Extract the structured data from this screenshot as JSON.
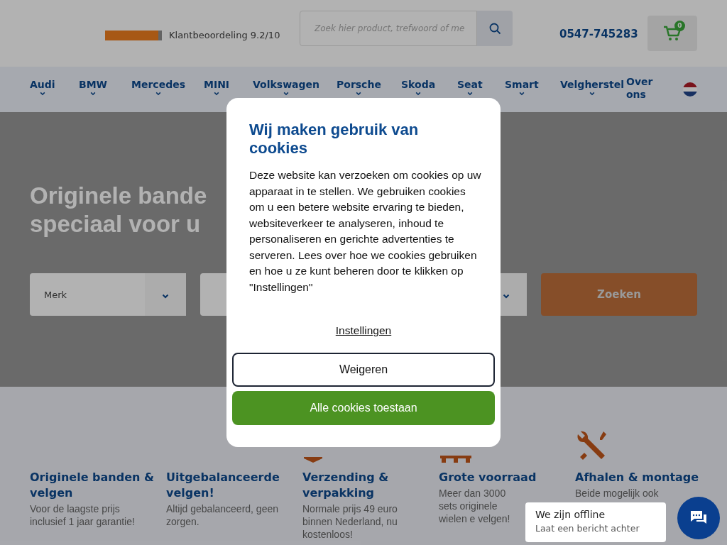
{
  "header": {
    "rating": {
      "level": 0.94,
      "text": "Klantbeoordeling 9.2/10"
    },
    "search": {
      "placeholder": "Zoek hier product, trefwoord of me"
    },
    "phone": "0547-745283",
    "cart": {
      "count": "0"
    }
  },
  "nav": {
    "items": [
      {
        "label": "Audi",
        "has_dropdown": true
      },
      {
        "label": "BMW",
        "has_dropdown": true
      },
      {
        "label": "Mercedes",
        "has_dropdown": true
      },
      {
        "label": "MINI",
        "has_dropdown": true
      },
      {
        "label": "Volkswagen",
        "has_dropdown": true
      },
      {
        "label": "Porsche",
        "has_dropdown": true
      },
      {
        "label": "Skoda",
        "has_dropdown": true
      },
      {
        "label": "Seat",
        "has_dropdown": true
      },
      {
        "label": "Smart",
        "has_dropdown": true
      },
      {
        "label": "Velgherstel",
        "has_dropdown": true
      },
      {
        "label": "Over ons",
        "has_dropdown": false
      }
    ]
  },
  "hero": {
    "title_lines": [
      "Originele bande",
      "speciaal voor u"
    ],
    "selects": [
      {
        "kind": "select",
        "placeholder": "Merk"
      },
      {
        "kind": "select"
      },
      {
        "kind": "select"
      }
    ],
    "search_button": "Zoeken"
  },
  "features": [
    {
      "title": "Originele banden & velgen",
      "text": "Voor de laagste prijs inclusief 1 jaar garantie!"
    },
    {
      "title": "Uitgebalanceerde velgen!",
      "text": "Altijd gebalanceerd, geen zorgen."
    },
    {
      "title": "Verzending & verpakking",
      "text": "Normale prijs 49 euro binnen Nederland, nu kostenloos!"
    },
    {
      "title": "Grote voorraad",
      "text": "Meer dan 3000 sets originele wielen e velgen!"
    },
    {
      "title": "Afhalen & montage",
      "text": "Beide mogelijk ook"
    }
  ],
  "cookie_dialog": {
    "title": "Wij maken gebruik van cookies",
    "text": "Deze website kan verzoeken om cookies op uw apparaat in te stellen. We gebruiken cookies om u een betere website ervaring te bieden, websiteverkeer te analyseren, inhoud te personaliseren en gerichte advertenties te serveren. Lees over hoe we cookies gebruiken en hoe u ze kunt beheren door te klikken op \"Instellingen\"",
    "settings_link": "Instellingen",
    "buttons": [
      {
        "label": "Weigeren",
        "kind": "outline"
      },
      {
        "label": "Alle cookies toestaan",
        "kind": "primary"
      }
    ]
  },
  "chat": {
    "status": "We zijn offline",
    "subtitle": "Laat een bericht achter"
  }
}
